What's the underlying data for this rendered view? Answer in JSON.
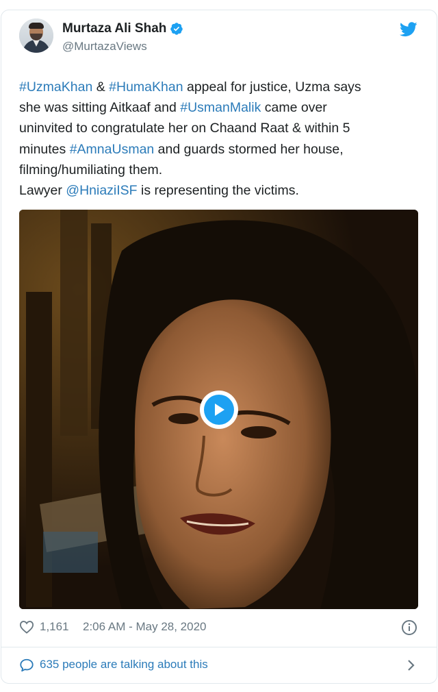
{
  "tweet": {
    "author": {
      "display_name": "Murtaza Ali Shah",
      "handle": "@MurtazaViews",
      "verified": true
    },
    "text": {
      "line1": [
        "#UzmaKhan",
        " & ",
        "#HumaKhan",
        " appeal for justice, Uzma says"
      ],
      "line2": "she was sitting Aitkaaf and ",
      "line2_link": "#UsmanMalik",
      "line2_end": " came over",
      "line3": "uninvited to congratulate her on Chaand Raat & within 5",
      "line4_start": "minutes ",
      "line4_link": "#AmnaUsman",
      "line4_end": " and guards stormed her house,",
      "line5": "filming/humiliating them.",
      "line6_start": "Lawyer ",
      "line6_link": "@HniaziISF",
      "line6_end": " is representing the victims."
    },
    "likes": "1,161",
    "timestamp": "2:06 AM - May 28, 2020",
    "conversation": "635 people are talking about this"
  },
  "icons": {
    "brand": "twitter-bird-icon",
    "verified": "verified-badge-icon",
    "like": "heart-icon",
    "info": "info-icon",
    "reply": "speech-bubble-icon",
    "more": "chevron-right-icon",
    "play": "play-icon"
  },
  "colors": {
    "link": "#2b7bb9",
    "secondary_text": "#697882",
    "twitter_blue": "#1da1f2",
    "border": "#e1e8ed"
  }
}
